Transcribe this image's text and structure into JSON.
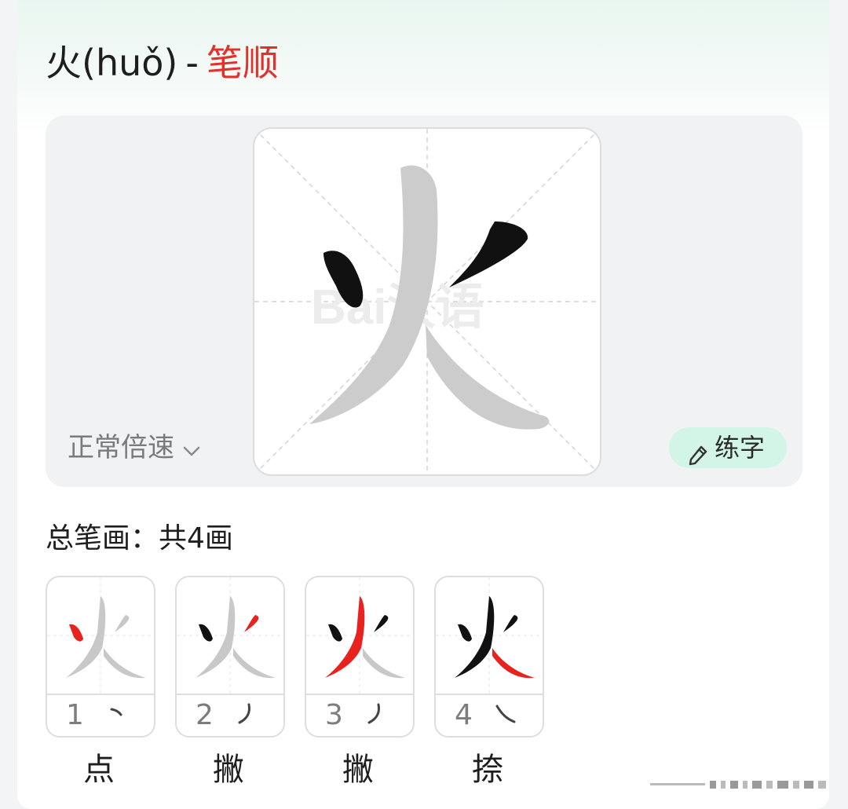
{
  "header": {
    "character": "火",
    "pinyin": "(huǒ)",
    "separator": "-",
    "section_label": "笔顺"
  },
  "stage": {
    "watermark": "Bai汉语",
    "speed_label": "正常倍速",
    "speed_icon": "chevron-down-icon",
    "practice_label": "练字",
    "practice_icon": "pencil-icon"
  },
  "stroke_count": {
    "label": "总笔画：",
    "value": "共4画"
  },
  "strokes": [
    {
      "index": "1",
      "name": "点"
    },
    {
      "index": "2",
      "name": "撇"
    },
    {
      "index": "3",
      "name": "撇"
    },
    {
      "index": "4",
      "name": "捺"
    }
  ],
  "colors": {
    "title_accent": "#e0312b",
    "stroke_highlight": "#e8231f",
    "stroke_done": "#111111",
    "stroke_pending": "#c8c8c8",
    "practice_bg": "#d3f5e7"
  }
}
